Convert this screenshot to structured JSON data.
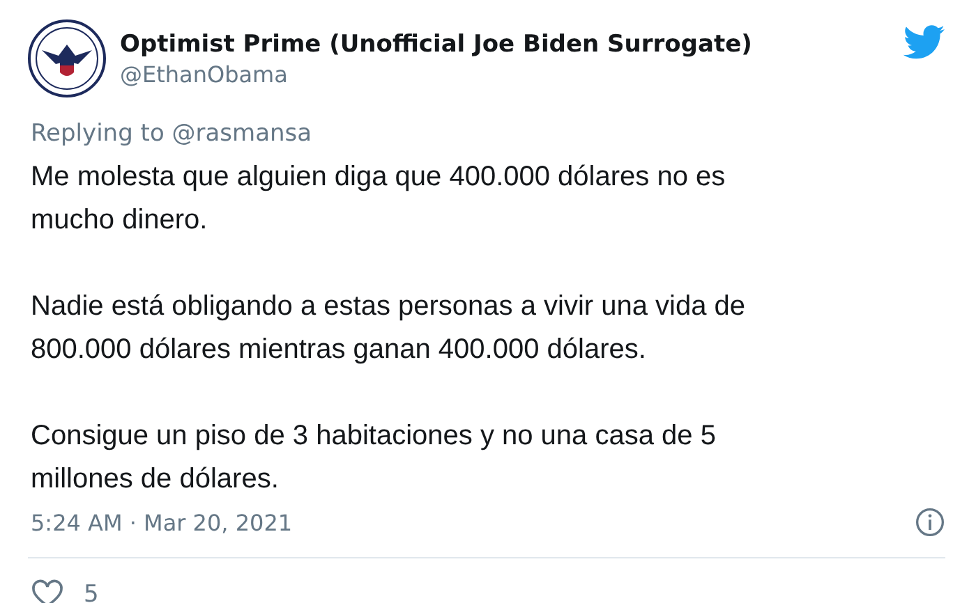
{
  "author": {
    "name": "Optimist Prime (Unofficial Joe Biden Surrogate)",
    "handle": "@EthanObama"
  },
  "replying_to": {
    "label": "Replying to",
    "handle": "@rasmansa"
  },
  "body": [
    [
      "Me molesta que alguien diga que 400.000 dólares no es",
      "mucho dinero."
    ],
    [
      "Nadie está obligando a estas personas a vivir una vida de",
      "800.000 dólares mientras ganan 400.000 dólares."
    ],
    [
      "Consigue un piso de 3 habitaciones y no una casa de 5",
      "millones de dólares."
    ]
  ],
  "timestamp": "5:24 AM · Mar 20, 2021",
  "likes": "5"
}
